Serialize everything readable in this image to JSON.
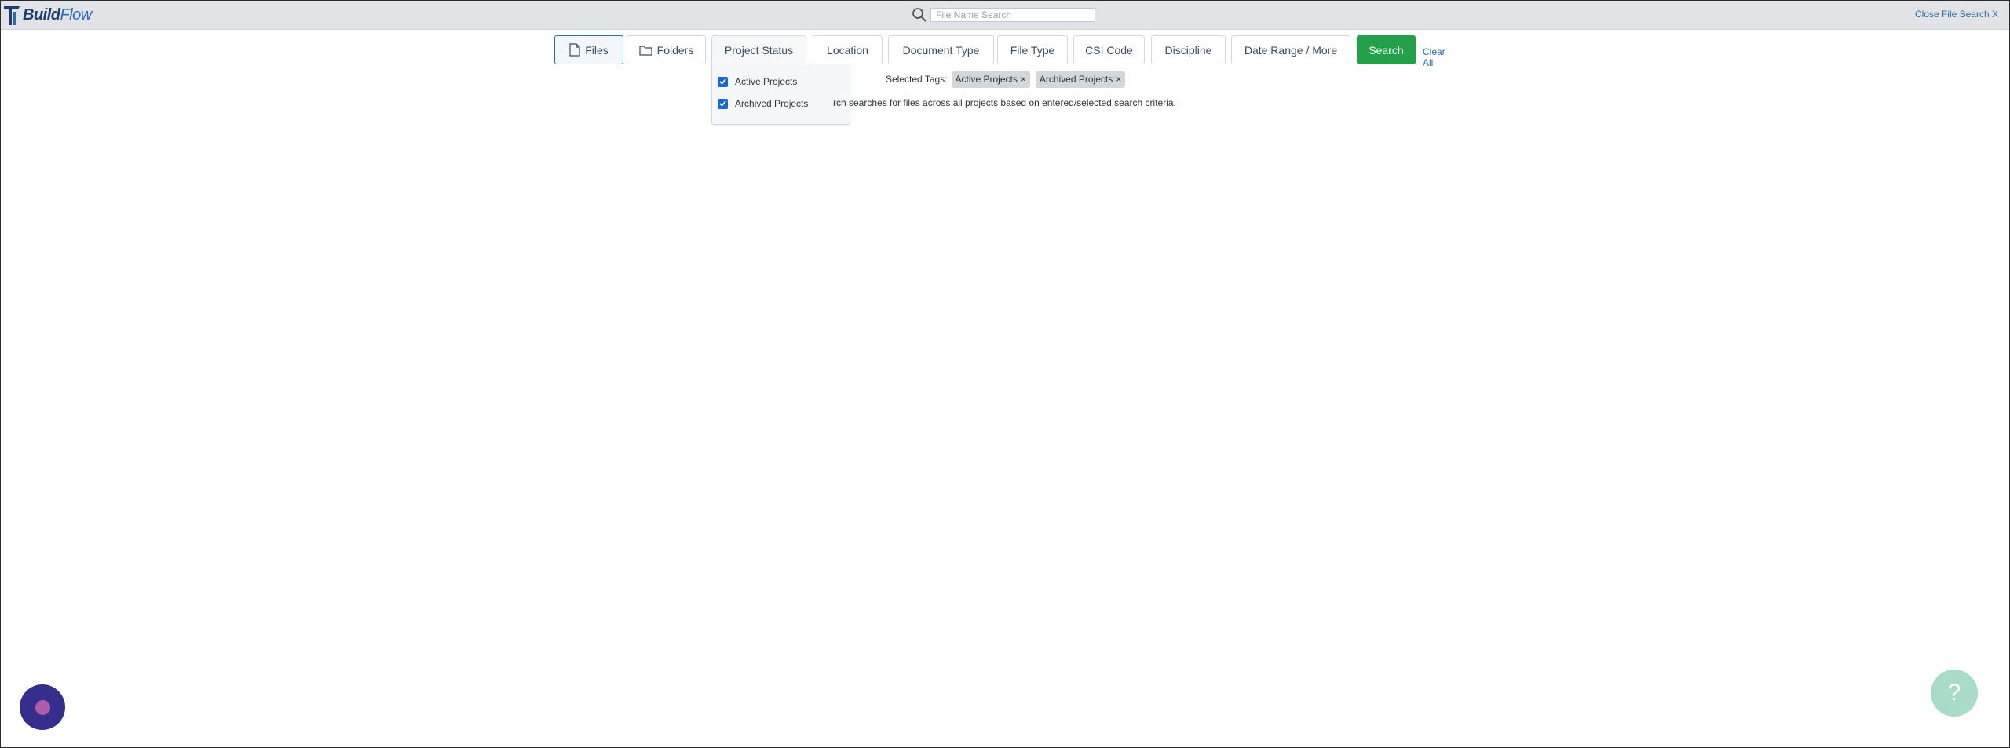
{
  "app": {
    "logo_text_1": "Build",
    "logo_text_2": "Flow"
  },
  "header": {
    "search_placeholder": "File Name Search",
    "close_label": "Close File Search X"
  },
  "filters": {
    "files": "Files",
    "folders": "Folders",
    "project_status": "Project Status",
    "location": "Location",
    "document_type": "Document Type",
    "file_type": "File Type",
    "csi_code": "CSI Code",
    "discipline": "Discipline",
    "date_range": "Date Range / More",
    "search": "Search",
    "clear_all": "Clear All"
  },
  "dropdown": {
    "items": [
      {
        "label": "Active Projects",
        "checked": true
      },
      {
        "label": "Archived Projects",
        "checked": true
      }
    ]
  },
  "tags": {
    "label": "Selected Tags:",
    "items": [
      "Active Projects",
      "Archived Projects"
    ],
    "remove_glyph": "×"
  },
  "info": {
    "text": "rch searches for files across all projects based on entered/selected search criteria."
  },
  "help": {
    "glyph": "?"
  },
  "colors": {
    "accent": "#2a6cb0",
    "search_button": "#22a04a",
    "checkbox": "#1a67d2",
    "chat_bubble": "#352e8d",
    "help_bubble": "#a8dcc8"
  }
}
